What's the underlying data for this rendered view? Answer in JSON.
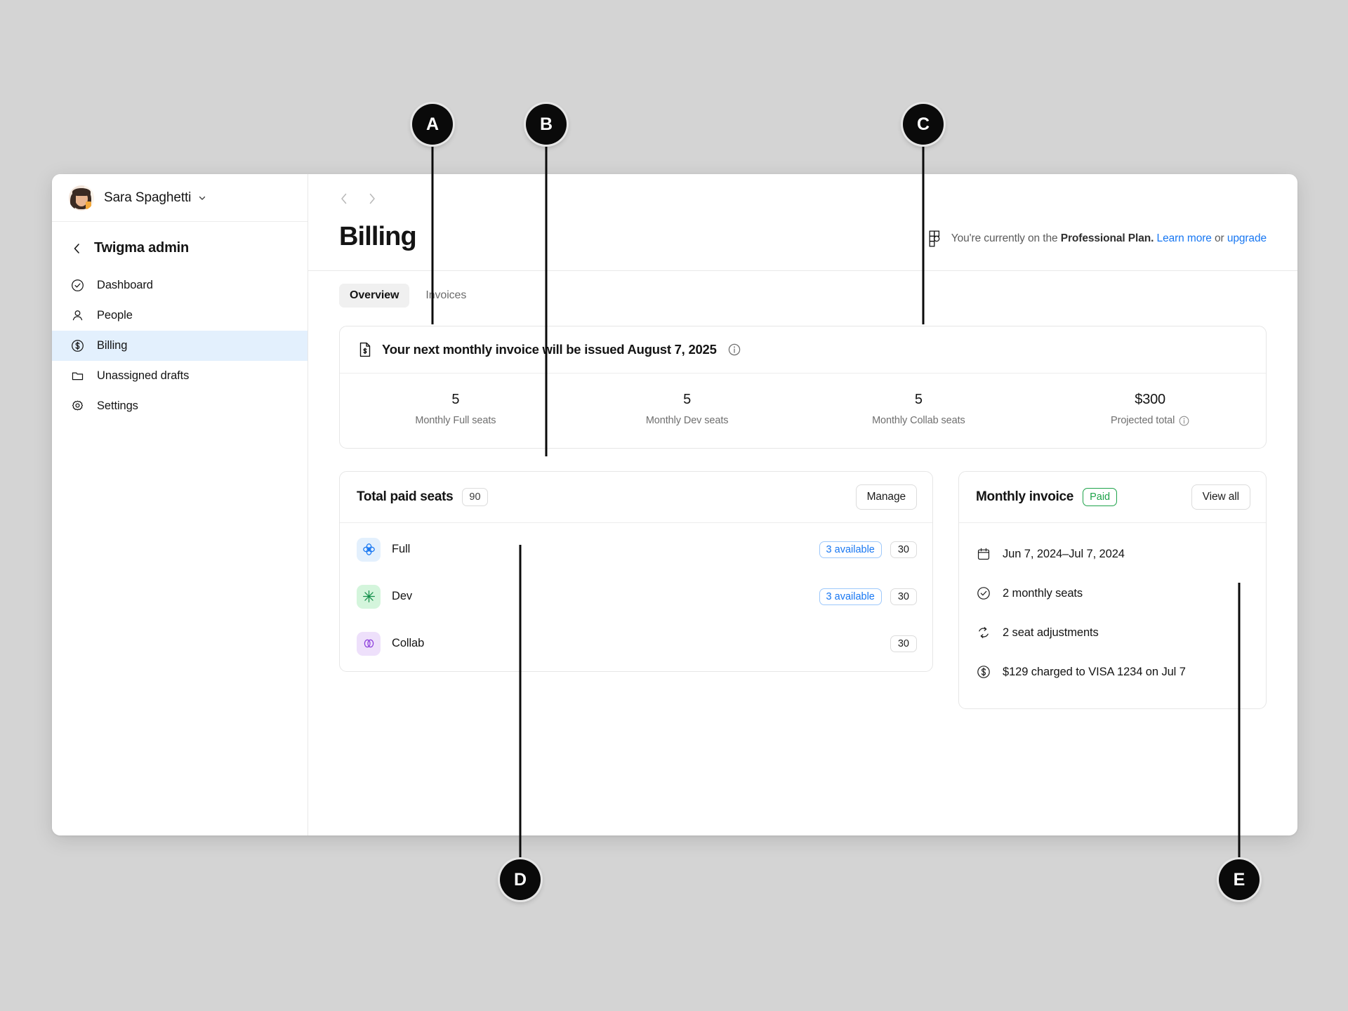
{
  "sidebar": {
    "user": {
      "name": "Sara Spaghetti",
      "caret": "⌄"
    },
    "back_title": "Twigma admin",
    "items": [
      {
        "label": "Dashboard",
        "icon": "check-circle-icon"
      },
      {
        "label": "People",
        "icon": "person-icon"
      },
      {
        "label": "Billing",
        "icon": "dollar-circle-icon"
      },
      {
        "label": "Unassigned drafts",
        "icon": "folder-icon"
      },
      {
        "label": "Settings",
        "icon": "gear-icon"
      }
    ]
  },
  "header": {
    "page_title": "Billing",
    "plan_prefix": "You're currently on the ",
    "plan_name": "Professional Plan.",
    "learn_more": "Learn more",
    "plan_or": " or ",
    "upgrade": "upgrade"
  },
  "tabs": [
    {
      "label": "Overview",
      "active": true
    },
    {
      "label": "Invoices",
      "active": false
    }
  ],
  "invoice_banner": {
    "title": "Your next monthly invoice will be issued August 7, 2025",
    "stats": [
      {
        "value": "5",
        "label": "Monthly Full seats",
        "info": false
      },
      {
        "value": "5",
        "label": "Monthly Dev seats",
        "info": false
      },
      {
        "value": "5",
        "label": "Monthly Collab seats",
        "info": false
      },
      {
        "value": "$300",
        "label": "Projected total",
        "info": true
      }
    ]
  },
  "seats_card": {
    "title": "Total paid seats",
    "total": "90",
    "manage_label": "Manage",
    "rows": [
      {
        "name": "Full",
        "available": "3 available",
        "count": "30",
        "icon": "full-seat-icon",
        "bg": "#e3f0fd",
        "fg": "#1877f2"
      },
      {
        "name": "Dev",
        "available": "3 available",
        "count": "30",
        "icon": "dev-seat-icon",
        "bg": "#d4f5dc",
        "fg": "#138f4a"
      },
      {
        "name": "Collab",
        "available": "",
        "count": "30",
        "icon": "collab-seat-icon",
        "bg": "#eee0fb",
        "fg": "#8b3ddb"
      }
    ]
  },
  "invoice_card": {
    "title": "Monthly invoice",
    "status": "Paid",
    "view_all_label": "View all",
    "items": [
      {
        "text": "Jun 7, 2024–Jul 7, 2024",
        "icon": "calendar-icon"
      },
      {
        "text": "2 monthly seats",
        "icon": "check-circle-icon"
      },
      {
        "text": "2 seat adjustments",
        "icon": "refresh-icon"
      },
      {
        "text": "$129 charged to VISA 1234 on Jul 7",
        "icon": "dollar-circle-icon"
      }
    ]
  },
  "callouts": [
    {
      "letter": "A"
    },
    {
      "letter": "B"
    },
    {
      "letter": "C"
    },
    {
      "letter": "D"
    },
    {
      "letter": "E"
    }
  ],
  "colors": {
    "accent_blue": "#1877f2",
    "green": "#1ea34a",
    "active_nav": "#e3f0fd"
  }
}
